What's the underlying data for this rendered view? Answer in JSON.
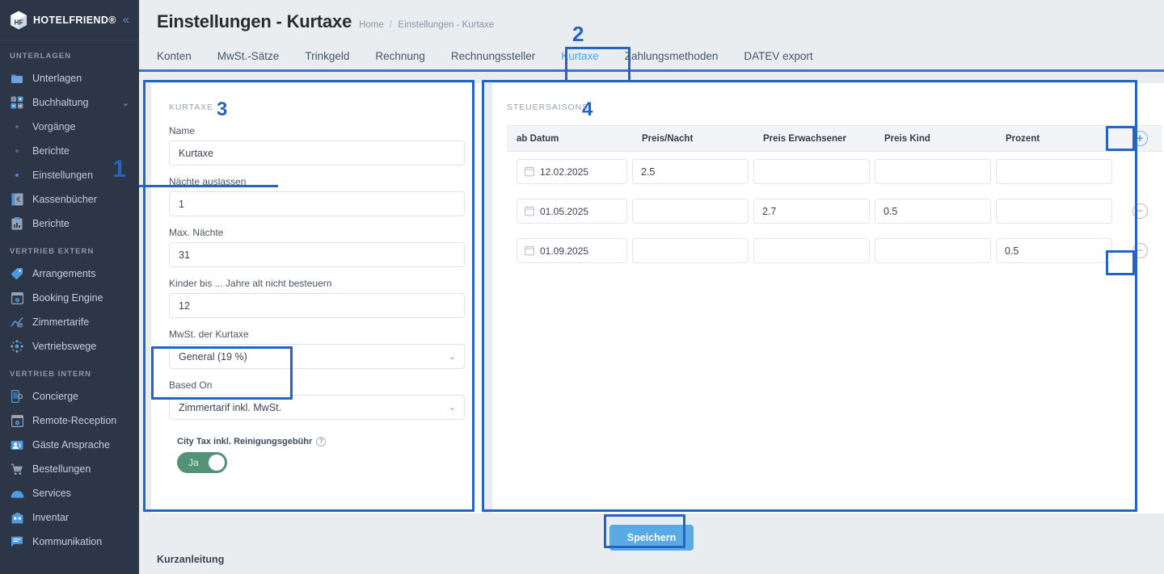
{
  "brand": {
    "name": "HOTELFRIEND®",
    "logo_icon": "cube-logo-icon",
    "collapse_icon": "chevron-double-left-icon"
  },
  "sidebar": {
    "sections": [
      {
        "label": "UNTERLAGEN",
        "items": [
          {
            "label": "Unterlagen",
            "icon": "folder-icon",
            "type": "top",
            "active": false
          },
          {
            "label": "Buchhaltung",
            "icon": "calculator-grid-icon",
            "type": "top",
            "active": true,
            "expanded": true,
            "chevron": "chevron-down-icon"
          },
          {
            "label": "Vorgänge",
            "icon": "dot-icon",
            "type": "sub",
            "active": false
          },
          {
            "label": "Berichte",
            "icon": "dot-icon",
            "type": "sub",
            "active": false
          },
          {
            "label": "Einstellungen",
            "icon": "dot-icon",
            "type": "sub",
            "active": true
          },
          {
            "label": "Kassenbücher",
            "icon": "cashbook-icon",
            "type": "top",
            "active": false
          },
          {
            "label": "Berichte",
            "icon": "clipboard-chart-icon",
            "type": "top",
            "active": false
          }
        ]
      },
      {
        "label": "VERTRIEB EXTERN",
        "items": [
          {
            "label": "Arrangements",
            "icon": "tag-icon",
            "type": "top",
            "active": false
          },
          {
            "label": "Booking Engine",
            "icon": "browser-gear-icon",
            "type": "top",
            "active": false
          },
          {
            "label": "Zimmertarife",
            "icon": "chart-up-icon",
            "type": "top",
            "active": false
          },
          {
            "label": "Vertriebswege",
            "icon": "network-nodes-icon",
            "type": "top",
            "active": false
          }
        ]
      },
      {
        "label": "VERTRIEB INTERN",
        "items": [
          {
            "label": "Concierge",
            "icon": "mobile-gear-icon",
            "type": "top",
            "active": false
          },
          {
            "label": "Remote-Reception",
            "icon": "browser-gear-icon",
            "type": "top",
            "active": false
          },
          {
            "label": "Gäste Ansprache",
            "icon": "speaker-person-icon",
            "type": "top",
            "active": false
          },
          {
            "label": "Bestellungen",
            "icon": "shopping-cart-icon",
            "type": "top",
            "active": false
          },
          {
            "label": "Services",
            "icon": "service-bell-icon",
            "type": "top",
            "active": false
          },
          {
            "label": "Inventar",
            "icon": "building-icon",
            "type": "top",
            "active": false
          },
          {
            "label": "Kommunikation",
            "icon": "chat-bubble-icon",
            "type": "top",
            "active": false
          }
        ]
      }
    ]
  },
  "header": {
    "title": "Einstellungen - Kurtaxe",
    "breadcrumb_home": "Home",
    "breadcrumb_sep": "/",
    "breadcrumb_current": "Einstellungen - Kurtaxe"
  },
  "tabs": [
    {
      "label": "Konten",
      "active": false
    },
    {
      "label": "MwSt.-Sätze",
      "active": false
    },
    {
      "label": "Trinkgeld",
      "active": false
    },
    {
      "label": "Rechnung",
      "active": false
    },
    {
      "label": "Rechnungssteller",
      "active": false
    },
    {
      "label": "Kurtaxe",
      "active": true
    },
    {
      "label": "Zahlungsmethoden",
      "active": false
    },
    {
      "label": "DATEV export",
      "active": false
    }
  ],
  "left_panel": {
    "caption": "KURTAXE",
    "fields": [
      {
        "label": "Name",
        "value": "Kurtaxe",
        "type": "text",
        "name": "name-field"
      },
      {
        "label": "Nächte auslassen",
        "value": "1",
        "type": "text",
        "name": "skip-nights-field"
      },
      {
        "label": "Max. Nächte",
        "value": "31",
        "type": "text",
        "name": "max-nights-field"
      },
      {
        "label": "Kinder bis ... Jahre alt nicht besteuern",
        "value": "12",
        "type": "text",
        "name": "children-age-field"
      },
      {
        "label": "MwSt. der Kurtaxe",
        "value": "General (19 %)",
        "type": "select",
        "name": "vat-select"
      },
      {
        "label": "Based On",
        "value": "Zimmertarif inkl. MwSt.",
        "type": "select",
        "name": "based-on-select"
      }
    ],
    "toggle": {
      "label": "City Tax inkl. Reinigungsgebühr",
      "help_icon": "question-mark-icon",
      "state_label": "Ja",
      "on": true,
      "on_color": "#539276"
    }
  },
  "right_panel": {
    "caption": "STEUERSAISONS",
    "columns": [
      "ab Datum",
      "Preis/Nacht",
      "Preis Erwachsener",
      "Preis Kind",
      "Prozent"
    ],
    "add_icon": "circle-plus-icon",
    "remove_icon": "circle-minus-icon",
    "calendar_icon": "calendar-icon",
    "rows": [
      {
        "date": "12.02.2025",
        "price_night": "2.5",
        "price_adult": "",
        "price_child": "",
        "percent": "",
        "removable": false
      },
      {
        "date": "01.05.2025",
        "price_night": "",
        "price_adult": "2.7",
        "price_child": "0.5",
        "percent": "",
        "removable": true
      },
      {
        "date": "01.09.2025",
        "price_night": "",
        "price_adult": "",
        "price_child": "",
        "percent": "0.5",
        "removable": true
      }
    ]
  },
  "footer": {
    "save_label": "Speichern",
    "guide_label": "Kurzanleitung"
  },
  "annotations": {
    "accent_color": "#2565c0",
    "markers": [
      {
        "number": "1",
        "target": "sidebar-item-einstellungen"
      },
      {
        "number": "2",
        "target": "tab-kurtaxe"
      },
      {
        "number": "3",
        "target": "left-panel"
      },
      {
        "number": "4",
        "target": "right-panel"
      }
    ]
  }
}
